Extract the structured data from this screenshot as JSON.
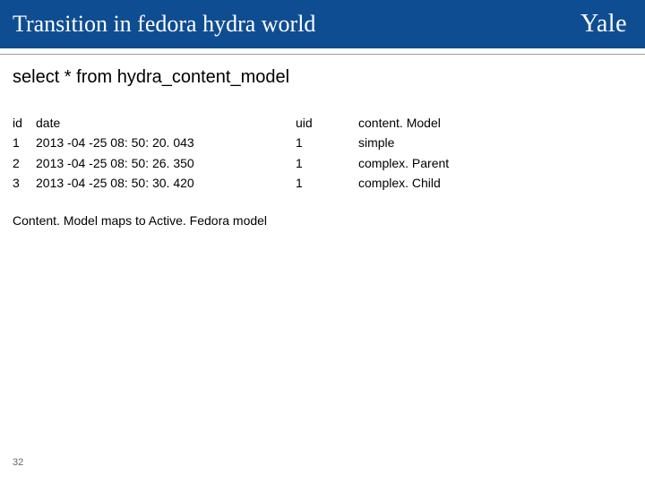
{
  "header": {
    "title": "Transition in fedora hydra world",
    "logo": "Yale"
  },
  "query": "select * from hydra_content_model",
  "table": {
    "cols": [
      "id",
      "date",
      "uid",
      "content. Model"
    ],
    "rows": [
      {
        "id": "1",
        "date": "2013 -04 -25 08: 50: 20. 043",
        "uid": "1",
        "content": "simple"
      },
      {
        "id": "2",
        "date": "2013 -04 -25 08: 50: 26. 350",
        "uid": "1",
        "content": "complex. Parent"
      },
      {
        "id": "3",
        "date": "2013 -04 -25 08: 50: 30. 420",
        "uid": "1",
        "content": "complex. Child"
      }
    ]
  },
  "note": "Content. Model maps to Active. Fedora model",
  "page_number": "32"
}
